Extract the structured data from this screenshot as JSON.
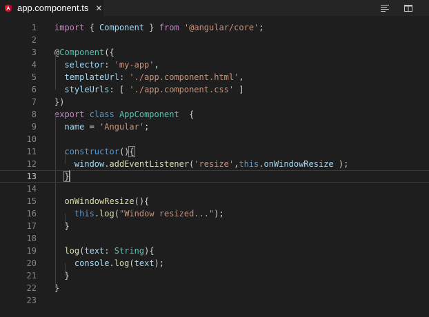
{
  "tab": {
    "label": "app.component.ts",
    "close": "✕",
    "file_icon": "angular-icon"
  },
  "toolbar": {
    "icons": [
      "toggle-minimap-icon",
      "split-editor-icon"
    ]
  },
  "colors": {
    "background": "#1e1e1e",
    "tabbar": "#252526",
    "keyword": "#c586c0",
    "storage": "#569cd6",
    "string": "#ce9178",
    "variable": "#9cdcfe",
    "type": "#4ec9b0",
    "function": "#dcdcaa",
    "line_number": "#858585"
  },
  "current_line": 13,
  "lines": [
    {
      "n": "1",
      "t": [
        [
          "import",
          "kw"
        ],
        [
          " { ",
          "br"
        ],
        [
          "Component",
          "id"
        ],
        [
          " } ",
          "br"
        ],
        [
          "from",
          "kw"
        ],
        [
          " ",
          "br"
        ],
        [
          "'@angular/core'",
          "str"
        ],
        [
          ";",
          "br"
        ]
      ]
    },
    {
      "n": "2",
      "t": []
    },
    {
      "n": "3",
      "t": [
        [
          "@",
          "br"
        ],
        [
          "Component",
          "cls"
        ],
        [
          "({",
          "br"
        ]
      ]
    },
    {
      "n": "4",
      "t": [
        [
          "  ",
          "br"
        ],
        [
          "selector",
          "id"
        ],
        [
          ": ",
          "br"
        ],
        [
          "'my-app'",
          "str"
        ],
        [
          ",",
          "br"
        ]
      ]
    },
    {
      "n": "5",
      "t": [
        [
          "  ",
          "br"
        ],
        [
          "templateUrl",
          "id"
        ],
        [
          ": ",
          "br"
        ],
        [
          "'./app.component.html'",
          "str"
        ],
        [
          ",",
          "br"
        ]
      ]
    },
    {
      "n": "6",
      "t": [
        [
          "  ",
          "br"
        ],
        [
          "styleUrls",
          "id"
        ],
        [
          ": [ ",
          "br"
        ],
        [
          "'./app.component.css'",
          "str"
        ],
        [
          " ]",
          "br"
        ]
      ]
    },
    {
      "n": "7",
      "t": [
        [
          "})",
          "br"
        ]
      ]
    },
    {
      "n": "8",
      "t": [
        [
          "export",
          "kw"
        ],
        [
          " ",
          "br"
        ],
        [
          "class",
          "kw2"
        ],
        [
          " ",
          "br"
        ],
        [
          "AppComponent",
          "cls"
        ],
        [
          "  {",
          "br"
        ]
      ]
    },
    {
      "n": "9",
      "t": [
        [
          "  ",
          "br"
        ],
        [
          "name",
          "id"
        ],
        [
          " = ",
          "br"
        ],
        [
          "'Angular'",
          "str"
        ],
        [
          ";",
          "br"
        ]
      ]
    },
    {
      "n": "10",
      "t": []
    },
    {
      "n": "11",
      "t": [
        [
          "  ",
          "br"
        ],
        [
          "constructor",
          "kw2"
        ],
        [
          "()",
          "br"
        ],
        [
          "{",
          "box"
        ]
      ]
    },
    {
      "n": "12",
      "t": [
        [
          "    ",
          "br"
        ],
        [
          "window",
          "id"
        ],
        [
          ".",
          "br"
        ],
        [
          "addEventListener",
          "fn"
        ],
        [
          "(",
          "br"
        ],
        [
          "'resize'",
          "str"
        ],
        [
          ",",
          "br"
        ],
        [
          "this",
          "kw2"
        ],
        [
          ".",
          "br"
        ],
        [
          "onWindowResize",
          "id"
        ],
        [
          " );",
          "br"
        ]
      ]
    },
    {
      "n": "13",
      "t": [
        [
          "  ",
          "br"
        ],
        [
          "}",
          "box"
        ]
      ]
    },
    {
      "n": "14",
      "t": []
    },
    {
      "n": "15",
      "t": [
        [
          "  ",
          "br"
        ],
        [
          "onWindowResize",
          "fn"
        ],
        [
          "(){",
          "br"
        ]
      ]
    },
    {
      "n": "16",
      "t": [
        [
          "    ",
          "br"
        ],
        [
          "this",
          "kw2"
        ],
        [
          ".",
          "br"
        ],
        [
          "log",
          "fn"
        ],
        [
          "(",
          "br"
        ],
        [
          "\"Window resized...\"",
          "str"
        ],
        [
          ");",
          "br"
        ]
      ]
    },
    {
      "n": "17",
      "t": [
        [
          "  }",
          "br"
        ]
      ]
    },
    {
      "n": "18",
      "t": []
    },
    {
      "n": "19",
      "t": [
        [
          "  ",
          "br"
        ],
        [
          "log",
          "fn"
        ],
        [
          "(",
          "br"
        ],
        [
          "text",
          "id"
        ],
        [
          ": ",
          "br"
        ],
        [
          "String",
          "cls"
        ],
        [
          "){",
          "br"
        ]
      ]
    },
    {
      "n": "20",
      "t": [
        [
          "    ",
          "br"
        ],
        [
          "console",
          "id"
        ],
        [
          ".",
          "br"
        ],
        [
          "log",
          "fn"
        ],
        [
          "(",
          "br"
        ],
        [
          "text",
          "id"
        ],
        [
          ");",
          "br"
        ]
      ]
    },
    {
      "n": "21",
      "t": [
        [
          "  }",
          "br"
        ]
      ]
    },
    {
      "n": "22",
      "t": [
        [
          "}",
          "br"
        ]
      ]
    },
    {
      "n": "23",
      "t": []
    }
  ]
}
